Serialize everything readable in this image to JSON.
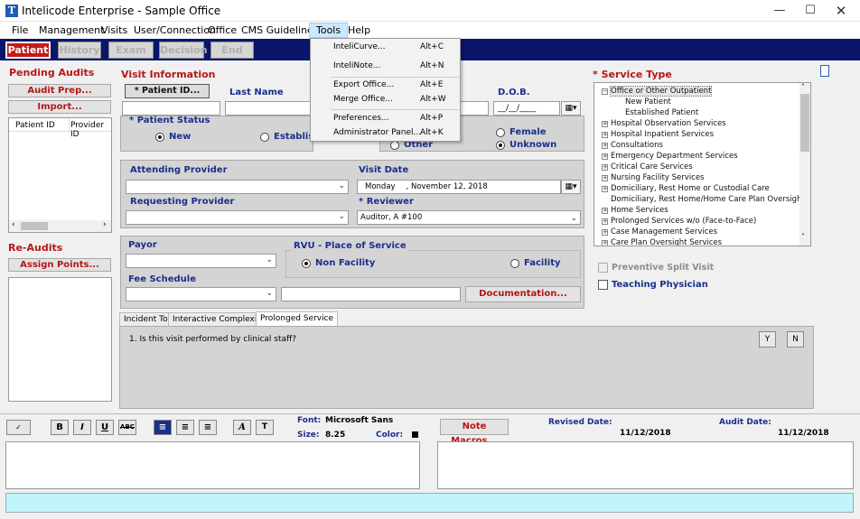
{
  "window": {
    "title": "Intelicode Enterprise - Sample Office",
    "icon_letter": "T"
  },
  "menubar": {
    "items": [
      "File",
      "Management",
      "Visits",
      "User/Connection",
      "Office",
      "CMS Guidelines",
      "Tools",
      "Help"
    ]
  },
  "toolstrip": {
    "buttons": [
      "Patient",
      "History",
      "Exam",
      "Decision",
      "End"
    ]
  },
  "tools_menu": {
    "items": [
      {
        "label": "InteliCurve...",
        "shortcut": "Alt+C"
      },
      {
        "label": "InteliNote...",
        "shortcut": "Alt+N"
      },
      {
        "label": "Export Office...",
        "shortcut": "Alt+E"
      },
      {
        "label": "Merge Office...",
        "shortcut": "Alt+W"
      },
      {
        "label": "Preferences...",
        "shortcut": "Alt+P"
      },
      {
        "label": "Administrator Panel...",
        "shortcut": "Alt+K"
      }
    ]
  },
  "left": {
    "pending_audits": "Pending Audits",
    "audit_prep": "Audit Prep...",
    "import": "Import...",
    "col_patient_id": "Patient ID",
    "col_provider_id": "Provider ID",
    "re_audits": "Re-Audits",
    "assign_points": "Assign Points..."
  },
  "visit": {
    "section": "Visit Information",
    "patient_id_btn": "* Patient ID...",
    "last_name": "Last Name",
    "dob": "D.O.B.",
    "dob_value": "__/__/____",
    "patient_status": "* Patient Status",
    "new": "New",
    "established": "Established",
    "other": "Other",
    "female": "Female",
    "unknown": "Unknown",
    "attending_provider": "Attending Provider",
    "visit_date": "Visit Date",
    "visit_day": "Monday",
    "visit_date_value": ", November 12, 2018",
    "requesting_provider": "Requesting Provider",
    "reviewer": "* Reviewer",
    "reviewer_value": "Auditor, A #100",
    "payor": "Payor",
    "rvu": "RVU - Place of Service",
    "non_facility": "Non Facility",
    "facility": "Facility",
    "fee_schedule": "Fee Schedule",
    "documentation": "Documentation..."
  },
  "service": {
    "section": "* Service Type",
    "tree": [
      {
        "label": "Office or Other Outpatient",
        "level": 0,
        "toggle": "-",
        "selected": true
      },
      {
        "label": "New Patient",
        "level": 1
      },
      {
        "label": "Established Patient",
        "level": 1
      },
      {
        "label": "Hospital Observation Services",
        "level": 0,
        "toggle": "+"
      },
      {
        "label": "Hospital Inpatient Services",
        "level": 0,
        "toggle": "+"
      },
      {
        "label": "Consultations",
        "level": 0,
        "toggle": "+"
      },
      {
        "label": "Emergency Department Services",
        "level": 0,
        "toggle": "+"
      },
      {
        "label": "Critical Care Services",
        "level": 0,
        "toggle": "+"
      },
      {
        "label": "Nursing Facility Services",
        "level": 0,
        "toggle": "+"
      },
      {
        "label": "Domiciliary, Rest Home or Custodial Care",
        "level": 0,
        "toggle": "+"
      },
      {
        "label": "Domiciliary, Rest Home/Home Care Plan Oversight",
        "level": 0,
        "toggle": ""
      },
      {
        "label": "Home Services",
        "level": 0,
        "toggle": "+"
      },
      {
        "label": "Prolonged Services w/o (Face-to-Face)",
        "level": 0,
        "toggle": "+"
      },
      {
        "label": "Case Management Services",
        "level": 0,
        "toggle": "+"
      },
      {
        "label": "Care Plan Oversight Services",
        "level": 0,
        "toggle": "+"
      }
    ],
    "preventive": "Preventive Split Visit",
    "teaching": "Teaching Physician"
  },
  "tabs": {
    "items": [
      "Incident To",
      "Interactive Complexity",
      "Prolonged Service"
    ],
    "selected": 2
  },
  "question": {
    "text": "1. Is this visit performed by clinical staff?",
    "yes": "Y",
    "no": "N"
  },
  "editor": {
    "font_label": "Font:",
    "font_value": "Microsoft Sans",
    "size_label": "Size:",
    "size_value": "8.25",
    "color_label": "Color:",
    "note_macros": "Note Macros...",
    "revised_date_label": "Revised Date:",
    "revised_date": "11/12/2018",
    "audit_date_label": "Audit Date:",
    "audit_date": "11/12/2018"
  },
  "colors": {
    "navy": "#0a1669",
    "accent_red": "#b51717",
    "label_blue": "#1a2f8c",
    "status_bar": "#bff5fb"
  }
}
